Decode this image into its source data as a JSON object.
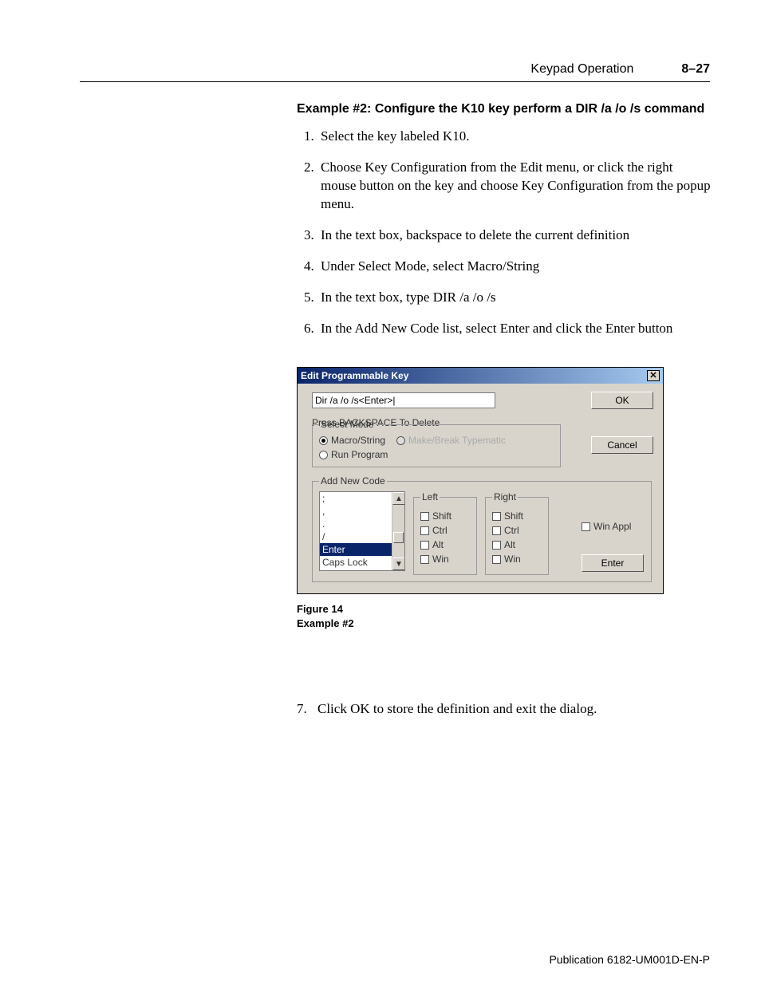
{
  "header": {
    "section": "Keypad Operation",
    "page": "8–27"
  },
  "example_title": "Example #2: Configure the K10 key perform a DIR /a /o /s command",
  "steps": [
    "Select the key labeled K10.",
    "Choose Key Configuration from the Edit menu, or click the right mouse button on the key and choose Key Configuration from the popup menu.",
    "In the text box, backspace to delete the current definition",
    "Under Select Mode, select Macro/String",
    "In the text box, type DIR /a /o /s",
    "In the Add New Code list, select Enter and click the Enter button"
  ],
  "dialog": {
    "title": "Edit Programmable Key",
    "close_glyph": "✕",
    "input_value": "Dir /a /o /s<Enter>|",
    "ok": "OK",
    "cancel": "Cancel",
    "hint": "Press BACKSPACE To Delete",
    "select_mode": {
      "legend": "Select Mode",
      "macro": "Macro/String",
      "mbt": "Make/Break Typematic",
      "run": "Run Program"
    },
    "add_new": {
      "legend": "Add New Code",
      "list": [
        ";",
        ",",
        ".",
        "/",
        "Enter",
        "Caps Lock"
      ],
      "selected": "Enter",
      "left": {
        "legend": "Left",
        "shift": "Shift",
        "ctrl": "Ctrl",
        "alt": "Alt",
        "win": "Win"
      },
      "right": {
        "legend": "Right",
        "shift": "Shift",
        "ctrl": "Ctrl",
        "alt": "Alt",
        "win": "Win"
      },
      "winappl": "Win Appl",
      "enter_btn": "Enter"
    }
  },
  "figure_caption": {
    "line1": "Figure 14",
    "line2": "Example #2"
  },
  "step7": "Click OK to store the definition and exit the dialog.",
  "footer": "Publication 6182-UM001D-EN-P"
}
